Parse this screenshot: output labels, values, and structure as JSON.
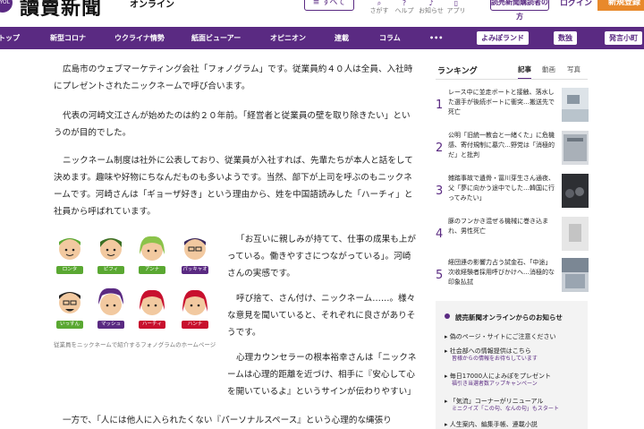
{
  "header": {
    "logo_badge": "YOL",
    "logo": "讀賣新聞",
    "logo_sub": "オンライン",
    "menu_label": "≡ すべて",
    "icons": [
      {
        "name": "search-icon",
        "label": "さがす"
      },
      {
        "name": "help-icon",
        "label": "ヘルプ"
      },
      {
        "name": "bell-icon",
        "label": "お知らせ"
      },
      {
        "name": "app-icon",
        "label": "アプリ"
      }
    ],
    "register_label": "読売新聞購読者の方",
    "login_label": "ログイン",
    "new_label": "新規登録"
  },
  "nav": {
    "items": [
      "トップ",
      "新型コロナ",
      "ウクライナ情勢",
      "紙面ビューアー",
      "オピニオン",
      "連載",
      "コラム",
      "•••"
    ],
    "pills": [
      "よみぽランド",
      "数独",
      "発言小町"
    ]
  },
  "article": {
    "paragraphs": [
      "広島市のウェブマーケティング会社「フォノグラム」です。従業員約４０人は全員、入社時にプレゼントされたニックネームで呼び合います。",
      "代表の河崎文江さんが始めたのは約２０年前。「経営者と従業員の壁を取り除きたい」というのが目的でした。",
      "ニックネーム制度は社外に公表しており、従業員が入社すれば、先輩たちが本人と話をして決めます。趣味や好物にちなんだものも多いようです。当然、部下が上司を呼ぶのもニックネームです。河崎さんは「ギョーザ好き」という理由から、姓を中国語読みした「ハーチィ」と社員から呼ばれています。"
    ],
    "side_paragraphs": [
      "「お互いに親しみが持てて、仕事の成果も上がっている。働きやすさにつながっている」。河崎さんの実感です。",
      "呼び捨て、さん付け、ニックネーム……。様々な意見を聞いていると、それぞれに良さがありそうです。",
      "心理カウンセラーの根本裕幸さんは「ニックネームは心理的距離を近づけ、相手に『安心して心を開いているよ』というサインが伝わりやすい」と話します。"
    ],
    "last_paragraph": "一方で、「人には他人に入られたくない『パーソナルスペース』という心理的な縄張り",
    "figure_caption": "従業員をニックネームで紹介するフォノグラムのホームページ",
    "faces": [
      {
        "tag": "ロンタ",
        "color": "#5aa832"
      },
      {
        "tag": "ピフィ",
        "color": "#5aa832"
      },
      {
        "tag": "アンナ",
        "color": "#5aa832"
      },
      {
        "tag": "パッキャオ",
        "color": "#5a2a82"
      },
      {
        "tag": "いっすん",
        "color": "#5aa832"
      },
      {
        "tag": "マッシュ",
        "color": "#5a2a82"
      },
      {
        "tag": "ハーチィ",
        "color": "#c8102e"
      },
      {
        "tag": "ハンナ",
        "color": "#c8102e"
      }
    ]
  },
  "sidebar": {
    "ranking_title": "ランキング",
    "tabs": [
      "記事",
      "動画",
      "写真"
    ],
    "items": [
      {
        "num": "1",
        "text": "レース中に並走ボートと接触、落水した選手が後続ボートに衝突…搬送先で死亡"
      },
      {
        "num": "2",
        "text": "公明「旧統一教会と一緒くた」に危機感、寄付規制に墓穴…野党は「消極的だ」と批判"
      },
      {
        "num": "3",
        "text": "雑踏事故で遺骨・冨川芽生さん通夜、父「夢に向かう途中でした…韓国に行ってみたい」"
      },
      {
        "num": "4",
        "text": "豚のフンかき混ぜる機械に巻き込まれ、男性死亡"
      },
      {
        "num": "5",
        "text": "経団連の影響力占う試金石、「中途」次收経験者採用呼びかけへ…消極的な印象払拭"
      }
    ],
    "notice_title": "読売新聞オンラインからのお知らせ",
    "notices": [
      {
        "text": "偽のページ・サイトにご注意ください",
        "sub": ""
      },
      {
        "text": "社会部への情報提供はこちら",
        "sub": "皆様からの情報をお待ちしています"
      },
      {
        "text": "毎日17000人によみぽをプレゼント",
        "sub": "福引き当選者数アップキャンペーン"
      },
      {
        "text": "「気流」コーナーがリニューアル",
        "sub": "ミニクイズ「この句、なんの句」もスタート"
      },
      {
        "text": "人生案内、編集手帳、連載小説",
        "sub": ""
      }
    ]
  }
}
